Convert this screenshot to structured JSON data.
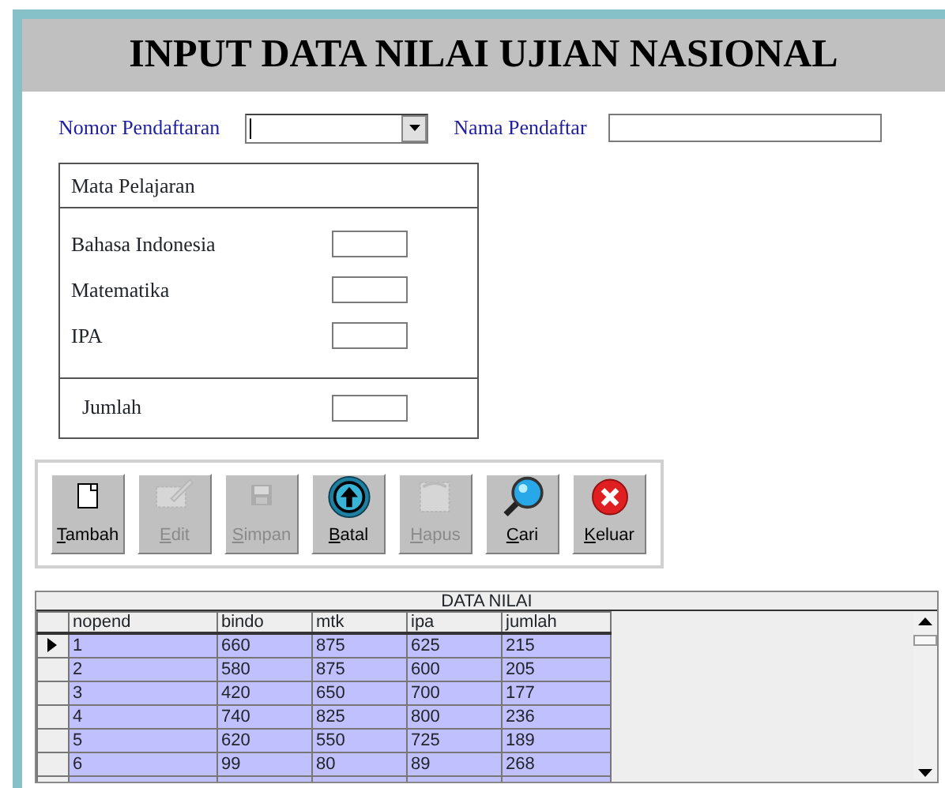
{
  "window": {
    "title": "INPUT DATA NILAI UJIAN NASIONAL"
  },
  "registration": {
    "number_label": "Nomor Pendaftaran",
    "name_label": "Nama Pendaftar"
  },
  "subjects": {
    "heading": "Mata Pelajaran",
    "items": [
      {
        "label": "Bahasa Indonesia"
      },
      {
        "label": "Matematika"
      },
      {
        "label": "IPA"
      }
    ],
    "total_label": "Jumlah"
  },
  "buttons": [
    {
      "label": "Tambah",
      "kind": "new",
      "disabled": false
    },
    {
      "label": "Edit",
      "kind": "edit",
      "disabled": true
    },
    {
      "label": "Simpan",
      "kind": "save",
      "disabled": true
    },
    {
      "label": "Batal",
      "kind": "cancel",
      "disabled": false
    },
    {
      "label": "Hapus",
      "kind": "delete",
      "disabled": true
    },
    {
      "label": "Cari",
      "kind": "search",
      "disabled": false
    },
    {
      "label": "Keluar",
      "kind": "exit",
      "disabled": false
    }
  ],
  "table": {
    "caption": "DATA NILAI",
    "columns": [
      "nopend",
      "bindo",
      "mtk",
      "ipa",
      "jumlah"
    ],
    "rows": [
      {
        "cells": [
          "1",
          "660",
          "875",
          "625",
          "215"
        ],
        "selected": true
      },
      {
        "cells": [
          "2",
          "580",
          "875",
          "600",
          "205"
        ],
        "selected": false
      },
      {
        "cells": [
          "3",
          "420",
          "650",
          "700",
          "177"
        ],
        "selected": false
      },
      {
        "cells": [
          "4",
          "740",
          "825",
          "800",
          "236"
        ],
        "selected": false
      },
      {
        "cells": [
          "5",
          "620",
          "550",
          "725",
          "189"
        ],
        "selected": false
      },
      {
        "cells": [
          "6",
          "99",
          "80",
          "89",
          "268"
        ],
        "selected": false
      }
    ]
  }
}
